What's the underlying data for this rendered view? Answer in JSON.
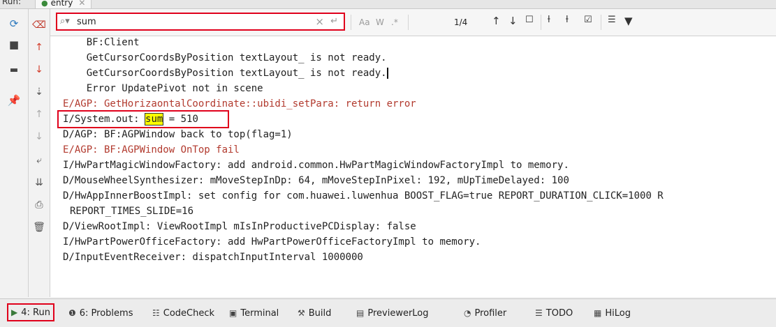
{
  "run_header": {
    "label": "Run:",
    "tab": "entry"
  },
  "left_toolbar": [
    "rerun-icon",
    "stop-icon",
    "layout-icon",
    "pin-icon"
  ],
  "side_toolbar": [
    "clear-icon",
    "up-icon",
    "down-icon",
    "sort-icon",
    "up-faded-icon",
    "down-faded-icon",
    "soft-wrap-icon",
    "scroll-end-icon",
    "print-icon",
    "trash-icon"
  ],
  "search": {
    "value": "sum",
    "matches": "1/4",
    "match_case": "Aa",
    "words": "W",
    "regex": ".*"
  },
  "console": {
    "lines": [
      "    BF:Client",
      "    GetCursorCoordsByPosition textLayout_ is not ready.",
      "    GetCursorCoordsByPosition textLayout_ is not ready.",
      "    Error UpdatePivot not in scene",
      "E/AGP: GetHorizaontalCoordinate::ubidi_setPara: return error",
      "I/System.out: ",
      "D/AGP: BF:AGPWindow back to top(flag=1)",
      "E/AGP: BF:AGPWindow OnTop fail",
      "I/HwPartMagicWindowFactory: add android.common.HwPartMagicWindowFactoryImpl to memory.",
      "D/MouseWheelSynthesizer: mMoveStepInDp: 64, mMoveStepInPixel: 192, mUpTimeDelayed: 100",
      "D/HwAppInnerBoostImpl: set config for com.huawei.luwenhua BOOST_FLAG=true REPORT_DURATION_CLICK=1000 R",
      "REPORT_TIMES_SLIDE=16",
      "D/ViewRootImpl: ViewRootImpl mIsInProductivePCDisplay: false",
      "I/HwPartPowerOfficeFactory: add HwPartPowerOfficeFactoryImpl to memory.",
      "D/InputEventReceiver: dispatchInputInterval 1000000"
    ],
    "highlight": "sum",
    "highlight_rest": " = 510"
  },
  "bottom_tabs": [
    {
      "label": "4: Run",
      "icon": "run-icon"
    },
    {
      "label": "6: Problems",
      "icon": "problems-icon"
    },
    {
      "label": "CodeCheck",
      "icon": "codecheck-icon"
    },
    {
      "label": "Terminal",
      "icon": "terminal-icon"
    },
    {
      "label": "Build",
      "icon": "build-icon"
    },
    {
      "label": "PreviewerLog",
      "icon": "previewerlog-icon"
    },
    {
      "label": "Profiler",
      "icon": "profiler-icon"
    },
    {
      "label": "TODO",
      "icon": "todo-icon"
    },
    {
      "label": "HiLog",
      "icon": "hilog-icon"
    }
  ],
  "colors": {
    "highlight_box": "#e0001b",
    "error_text": "#b23a2e",
    "match_bg": "#ffff00"
  }
}
